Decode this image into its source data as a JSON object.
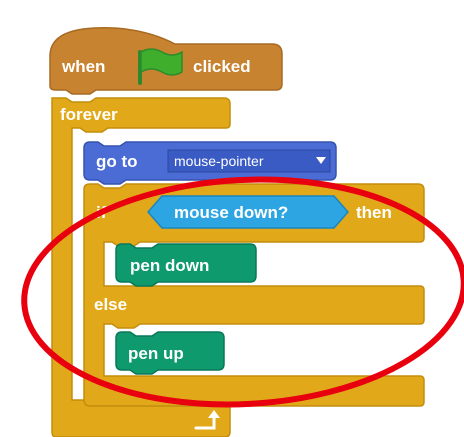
{
  "script": {
    "hat": {
      "label_before": "when",
      "label_after": "clicked",
      "icon": "green-flag-icon"
    },
    "forever_label": "forever",
    "go_to": {
      "label": "go to",
      "dropdown_value": "mouse-pointer"
    },
    "if_else": {
      "if_label": "if",
      "condition": "mouse down?",
      "then_label": "then",
      "else_label": "else"
    },
    "pen_down_label": "pen down",
    "pen_up_label": "pen up",
    "loop_icon": "loop-arrow-icon"
  },
  "annotation": {
    "shape": "ellipse",
    "color": "#e8000e"
  },
  "colors": {
    "events": "#c88330",
    "control": "#e1a91a",
    "motion": "#4a6cd4",
    "sensing": "#2ca5e2",
    "pen": "#0e9a6c",
    "dropdown": "#3a5ac4"
  }
}
